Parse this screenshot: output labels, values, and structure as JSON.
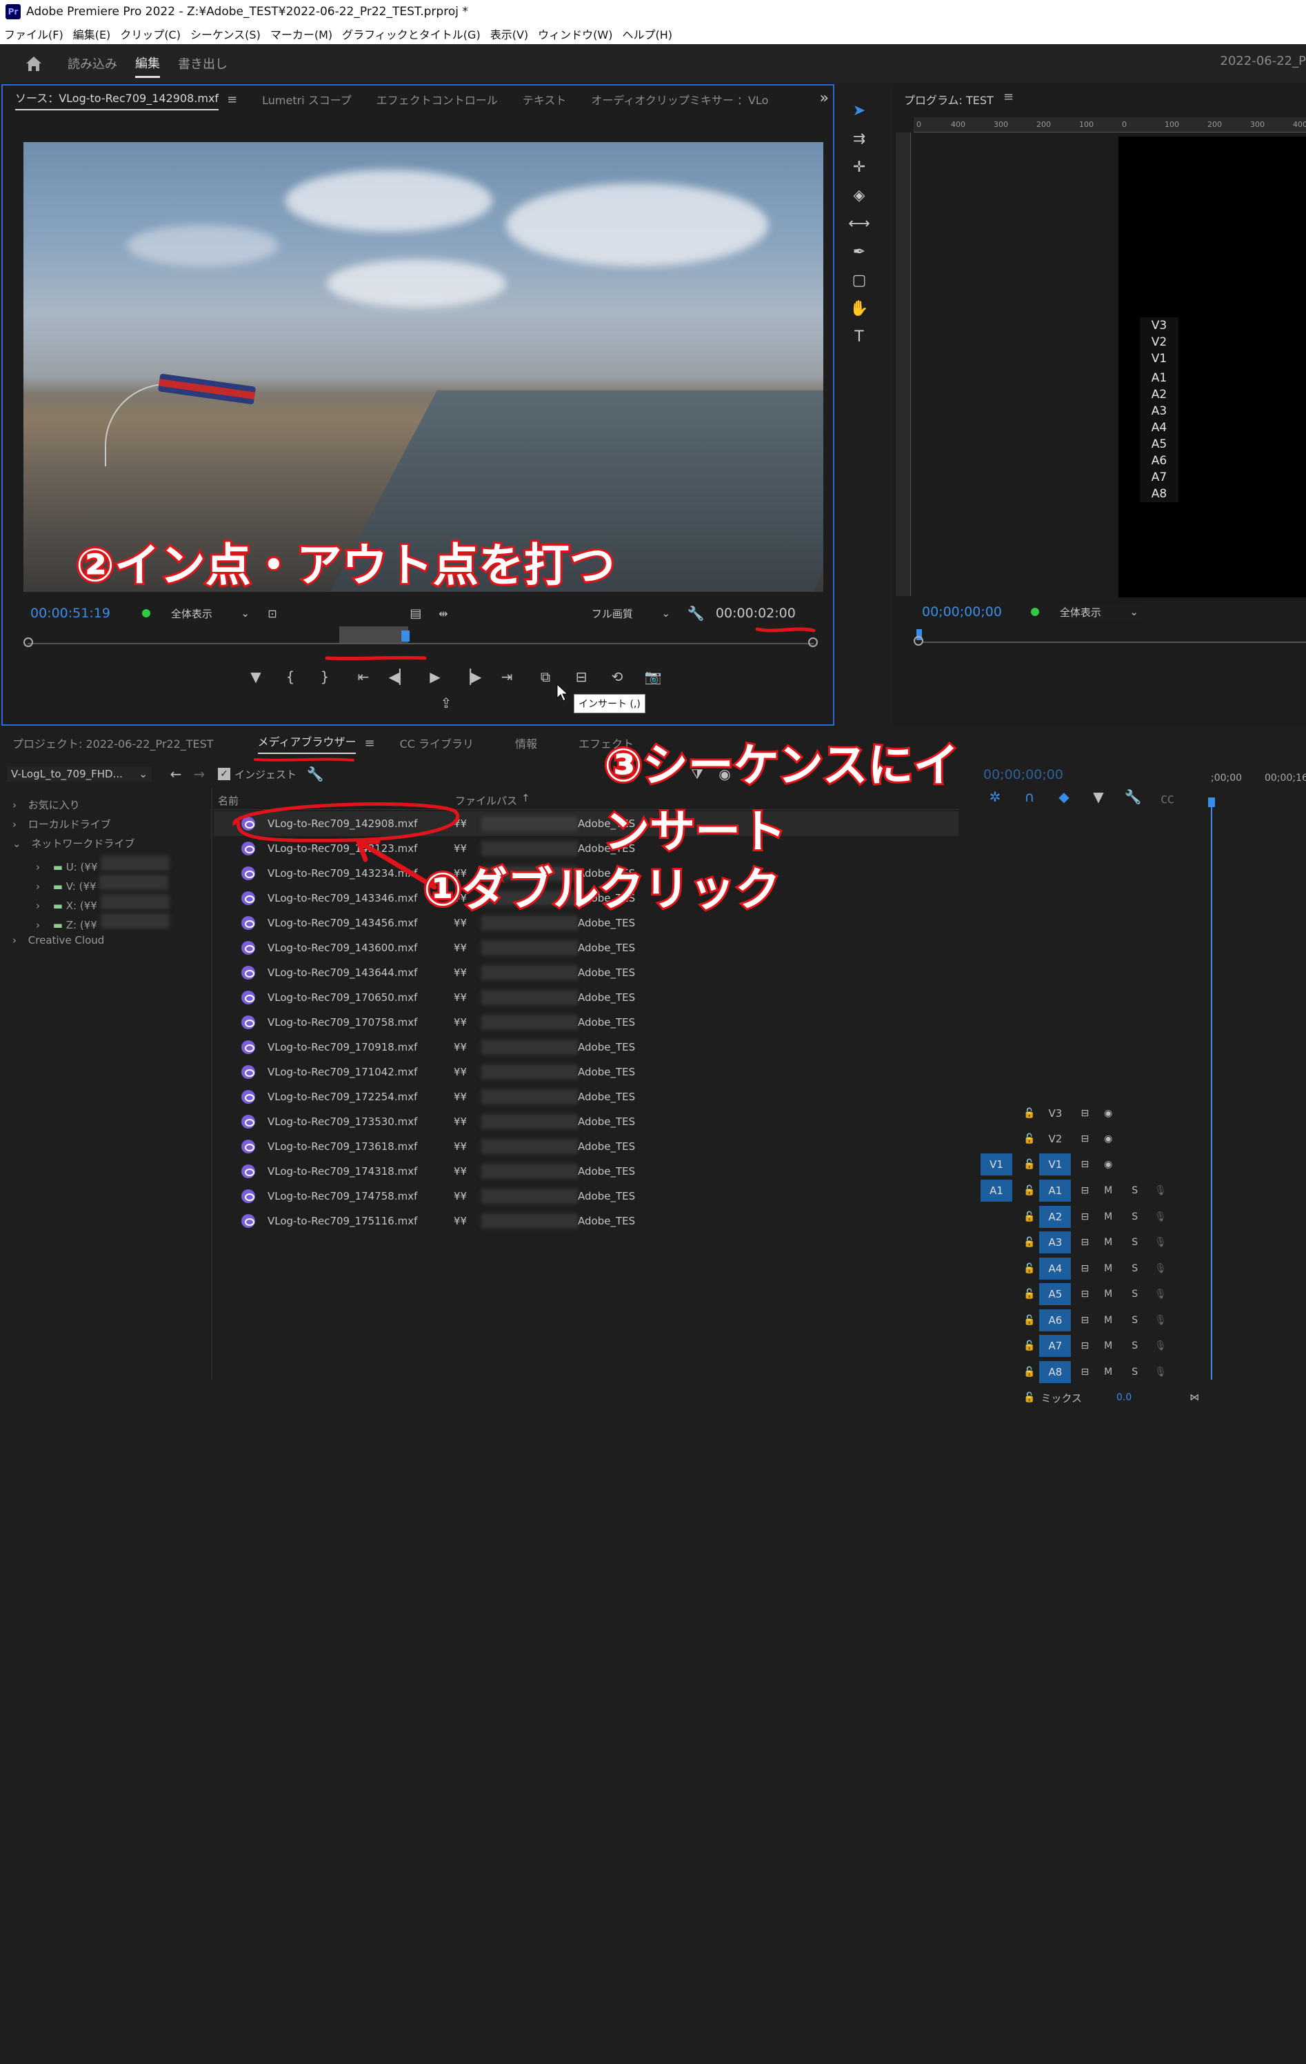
{
  "window": {
    "app_icon": "Pr",
    "title": "Adobe Premiere Pro 2022 - Z:¥Adobe_TEST¥2022-06-22_Pr22_TEST.prproj *"
  },
  "menubar": [
    "ファイル(F)",
    "編集(E)",
    "クリップ(C)",
    "シーケンス(S)",
    "マーカー(M)",
    "グラフィックとタイトル(G)",
    "表示(V)",
    "ウィンドウ(W)",
    "ヘルプ(H)"
  ],
  "workspace": {
    "tabs": [
      "読み込み",
      "編集",
      "書き出し"
    ],
    "active": "編集",
    "right_text": "2022-06-22_P"
  },
  "source_panel": {
    "tabs": [
      "ソース：VLog-to-Rec709_142908.mxf",
      "Lumetri スコープ",
      "エフェクトコントロール",
      "テキスト",
      "オーディオクリップミキサー ：VLo"
    ],
    "timecode": "00:00:51:19",
    "zoom": "全体表示",
    "quality": "フル画質",
    "duration": "00:00:02:00",
    "annotation": "②イン点・アウト点を打つ",
    "tooltip": "インサート (,)"
  },
  "program_panel": {
    "title": "プログラム: TEST",
    "ruler_labels": [
      "0",
      "400",
      "300",
      "200",
      "100",
      "0",
      "100",
      "200",
      "300",
      "400"
    ],
    "track_list": [
      "V3",
      "V2",
      "V1",
      "A1",
      "A2",
      "A3",
      "A4",
      "A5",
      "A6",
      "A7",
      "A8"
    ],
    "timecode": "00;00;00;00",
    "zoom": "全体表示"
  },
  "project_panel": {
    "tabs": [
      "プロジェクト: 2022-06-22_Pr22_TEST",
      "メディアブラウザー",
      "CC ライブラリ",
      "情報",
      "エフェクト"
    ],
    "active_tab": "メディアブラウザー",
    "ingest_preset": "V-LogL_to_709_FHD...",
    "ingest_label": "インジェスト",
    "tree": [
      "お気に入り",
      "ローカルドライブ",
      "ネットワークドライブ",
      "U: (¥¥",
      "V: (¥¥",
      "X: (¥¥",
      "Z: (¥¥",
      "Creative Cloud"
    ],
    "columns": {
      "name": "名前",
      "path": "ファイルパス"
    },
    "path_prefix": "¥¥",
    "path_suffix": "Adobe_TES",
    "files": [
      "VLog-to-Rec709_142908.mxf",
      "VLog-to-Rec709_143123.mxf",
      "VLog-to-Rec709_143234.mxf",
      "VLog-to-Rec709_143346.mxf",
      "VLog-to-Rec709_143456.mxf",
      "VLog-to-Rec709_143600.mxf",
      "VLog-to-Rec709_143644.mxf",
      "VLog-to-Rec709_170650.mxf",
      "VLog-to-Rec709_170758.mxf",
      "VLog-to-Rec709_170918.mxf",
      "VLog-to-Rec709_171042.mxf",
      "VLog-to-Rec709_172254.mxf",
      "VLog-to-Rec709_173530.mxf",
      "VLog-to-Rec709_173618.mxf",
      "VLog-to-Rec709_174318.mxf",
      "VLog-to-Rec709_174758.mxf",
      "VLog-to-Rec709_175116.mxf"
    ],
    "annotation_dblclick": "①ダブルクリック",
    "annotation_insert": "③シーケンスにインサート"
  },
  "timeline": {
    "timecode": "00;00;00;00",
    "ruler": [
      ";00;00",
      "00;00;16"
    ],
    "video_tracks": [
      "V3",
      "V2",
      "V1"
    ],
    "audio_tracks": [
      "A1",
      "A2",
      "A3",
      "A4",
      "A5",
      "A6",
      "A7",
      "A8"
    ],
    "mix_label": "ミックス",
    "mix_value": "0.0",
    "m": "M",
    "s": "S"
  },
  "colors": {
    "accent": "#2d6ad6",
    "timecode": "#3b8ee8",
    "annotation": "#e0141a",
    "track_blue": "#1d5e9e"
  }
}
